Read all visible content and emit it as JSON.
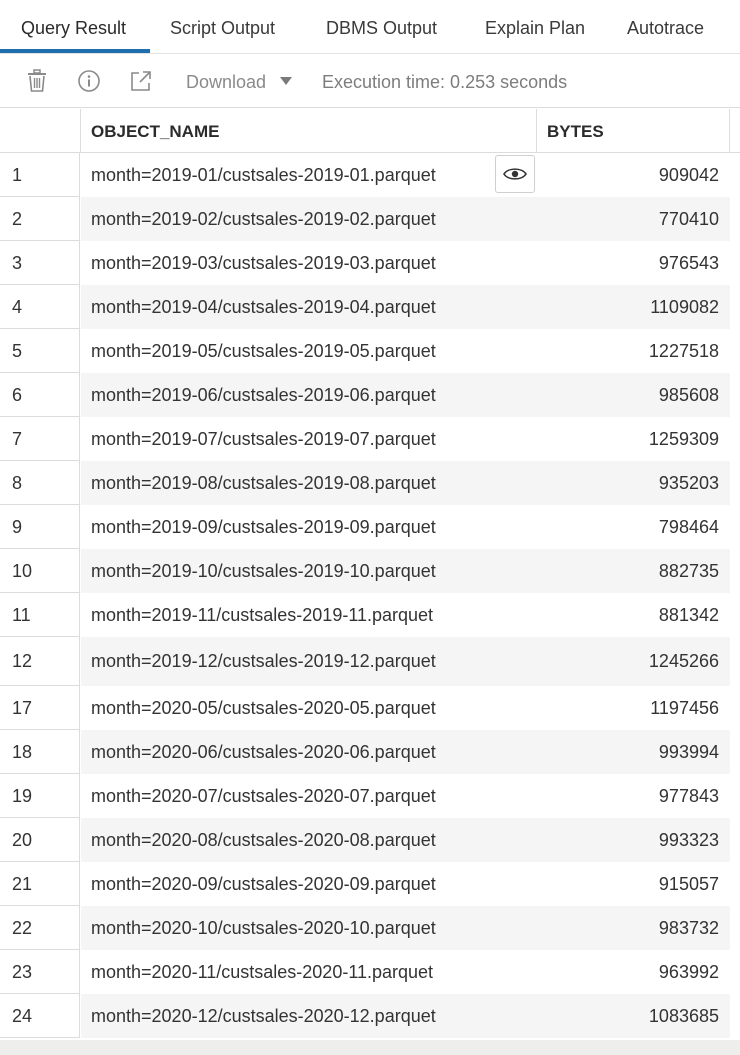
{
  "tabs": [
    {
      "label": "Query Result",
      "active": true
    },
    {
      "label": "Script Output",
      "active": false
    },
    {
      "label": "DBMS Output",
      "active": false
    },
    {
      "label": "Explain Plan",
      "active": false
    },
    {
      "label": "Autotrace",
      "active": false
    }
  ],
  "toolbar": {
    "icons": [
      "trash-icon",
      "info-icon",
      "open-external-icon"
    ],
    "download_label": "Download",
    "execution_time": "Execution time: 0.253 seconds"
  },
  "grid": {
    "columns": [
      "OBJECT_NAME",
      "BYTES"
    ],
    "rows": [
      {
        "num": "1",
        "name": "month=2019-01/custsales-2019-01.parquet",
        "bytes": "909042"
      },
      {
        "num": "2",
        "name": "month=2019-02/custsales-2019-02.parquet",
        "bytes": "770410"
      },
      {
        "num": "3",
        "name": "month=2019-03/custsales-2019-03.parquet",
        "bytes": "976543"
      },
      {
        "num": "4",
        "name": "month=2019-04/custsales-2019-04.parquet",
        "bytes": "1109082"
      },
      {
        "num": "5",
        "name": "month=2019-05/custsales-2019-05.parquet",
        "bytes": "1227518"
      },
      {
        "num": "6",
        "name": "month=2019-06/custsales-2019-06.parquet",
        "bytes": "985608"
      },
      {
        "num": "7",
        "name": "month=2019-07/custsales-2019-07.parquet",
        "bytes": "1259309"
      },
      {
        "num": "8",
        "name": "month=2019-08/custsales-2019-08.parquet",
        "bytes": "935203"
      },
      {
        "num": "9",
        "name": "month=2019-09/custsales-2019-09.parquet",
        "bytes": "798464"
      },
      {
        "num": "10",
        "name": "month=2019-10/custsales-2019-10.parquet",
        "bytes": "882735"
      },
      {
        "num": "11",
        "name": "month=2019-11/custsales-2019-11.parquet",
        "bytes": "881342"
      },
      {
        "num": "12",
        "name": "month=2019-12/custsales-2019-12.parquet",
        "bytes": "1245266"
      },
      {
        "num": "17",
        "name": "month=2020-05/custsales-2020-05.parquet",
        "bytes": "1197456"
      },
      {
        "num": "18",
        "name": "month=2020-06/custsales-2020-06.parquet",
        "bytes": "993994"
      },
      {
        "num": "19",
        "name": "month=2020-07/custsales-2020-07.parquet",
        "bytes": "977843"
      },
      {
        "num": "20",
        "name": "month=2020-08/custsales-2020-08.parquet",
        "bytes": "993323"
      },
      {
        "num": "21",
        "name": "month=2020-09/custsales-2020-09.parquet",
        "bytes": "915057"
      },
      {
        "num": "22",
        "name": "month=2020-10/custsales-2020-10.parquet",
        "bytes": "983732"
      },
      {
        "num": "23",
        "name": "month=2020-11/custsales-2020-11.parquet",
        "bytes": "963992"
      },
      {
        "num": "24",
        "name": "month=2020-12/custsales-2020-12.parquet",
        "bytes": "1083685"
      }
    ]
  },
  "colors": {
    "active_tab_underline": "#1f6fae",
    "alt_row": "#f5f5f5",
    "border": "#dcdcdc"
  }
}
